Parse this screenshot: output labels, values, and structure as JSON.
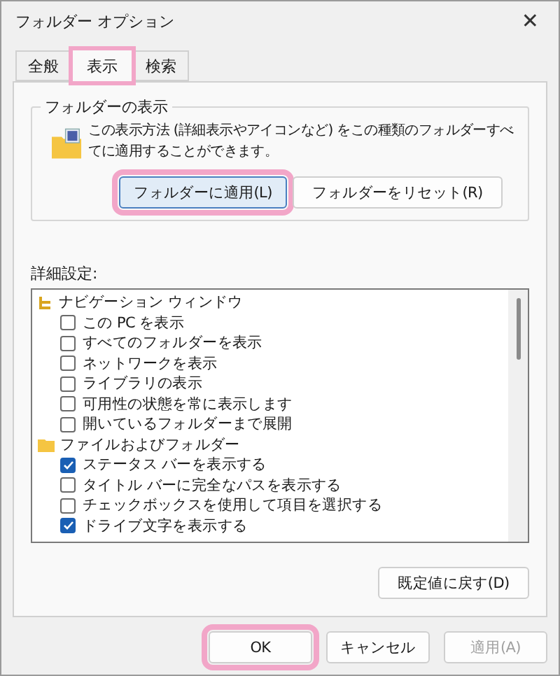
{
  "window": {
    "title": "フォルダー オプション",
    "close": "✕"
  },
  "tabs": [
    {
      "label": "全般",
      "selected": false,
      "highlighted": false
    },
    {
      "label": "表示",
      "selected": true,
      "highlighted": true
    },
    {
      "label": "検索",
      "selected": false,
      "highlighted": false
    }
  ],
  "folder_views": {
    "legend": "フォルダーの表示",
    "description": "この表示方法 (詳細表示やアイコンなど) をこの種類のフォルダーすべてに適用することができます。",
    "buttons": [
      {
        "label": "フォルダーに適用(L)",
        "focused": true,
        "highlighted": true
      },
      {
        "label": "フォルダーをリセット(R)",
        "focused": false,
        "highlighted": false
      }
    ]
  },
  "advanced": {
    "label": "詳細設定:",
    "categories": [
      {
        "label": "ナビゲーション ウィンドウ",
        "kind": "pane",
        "children": [
          {
            "label": "この PC を表示",
            "checked": false
          },
          {
            "label": "すべてのフォルダーを表示",
            "checked": false
          },
          {
            "label": "ネットワークを表示",
            "checked": false
          },
          {
            "label": "ライブラリの表示",
            "checked": false
          },
          {
            "label": "可用性の状態を常に表示します",
            "checked": false
          },
          {
            "label": "開いているフォルダーまで展開",
            "checked": false
          }
        ]
      },
      {
        "label": "ファイルおよびフォルダー",
        "kind": "folder",
        "children": [
          {
            "label": "ステータス バーを表示する",
            "checked": true
          },
          {
            "label": "タイトル バーに完全なパスを表示する",
            "checked": false
          },
          {
            "label": "チェックボックスを使用して項目を選択する",
            "checked": false
          },
          {
            "label": "ドライブ文字を表示する",
            "checked": true
          }
        ]
      }
    ],
    "restore": "既定値に戻す(D)"
  },
  "footer": [
    {
      "label": "OK",
      "disabled": false,
      "highlighted": true
    },
    {
      "label": "キャンセル",
      "disabled": false,
      "highlighted": false
    },
    {
      "label": "適用(A)",
      "disabled": true,
      "highlighted": false
    }
  ]
}
